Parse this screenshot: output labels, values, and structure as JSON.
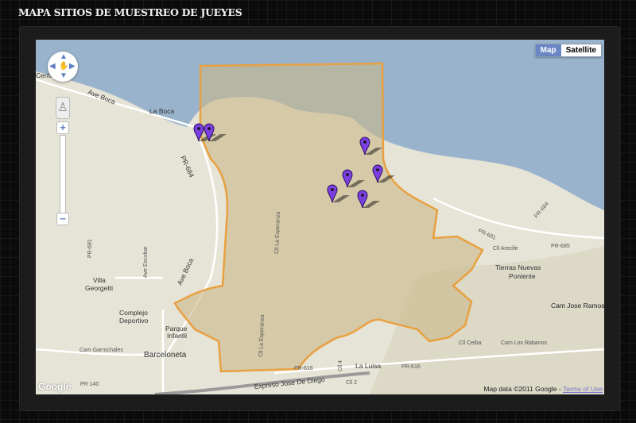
{
  "page_title": "MAPA SITIOS DE MUESTREO DE JUEYES",
  "map": {
    "type_buttons": [
      {
        "label": "Map",
        "active": true
      },
      {
        "label": "Satellite",
        "active": false
      }
    ],
    "attribution": "Map data ©2011 Google",
    "terms_link": "Terms of Use",
    "logo": "Google",
    "colors": {
      "sea": "#99b3cc",
      "land": "#e6e4d6",
      "polygon_fill": "#c9b889",
      "polygon_stroke": "#e8a040",
      "marker": "#7b3fe0"
    },
    "labels": {
      "centro": "Centro",
      "ave_boca_1": "Ave Boca",
      "la_boca": "La Boca",
      "pr684": "PR-684",
      "pr681": "PR-681",
      "ave_boca_2": "Ave Boca",
      "cll_esperanza_1": "Cll La Esperanza",
      "cll_esperanza_2": "Cll La Esperanza",
      "villa": "Villa",
      "georgetti": "Georgetti",
      "complejo": "Complejo",
      "deportivo": "Deportivo",
      "parque": "Parque",
      "infantil": "Infantil",
      "ave_escobar": "Ave Escobar",
      "barceloneta": "Barceloneta",
      "cam_garrochales": "Cam Garrochales",
      "pr140": "PR 140",
      "expreso": "Expreso Jose De Diego",
      "pr616_1": "PR-616",
      "pr616_2": "PR-616",
      "la_luisa": "La Luisa",
      "cll2": "Cll 2",
      "cll4": "Cll 4",
      "cll_ceiba": "Cll Ceiba",
      "cam_rabanos": "Cam Los Rabanos",
      "tierras": "Tierras Nuevas",
      "poniente": "Poniente",
      "cll_arecife": "Cll Arecife",
      "pr685": "PR-685",
      "pr684b": "PR-684",
      "pr681b": "PR-681",
      "cam_jose": "Cam Jose Ramos"
    },
    "markers": [
      "sitio-1",
      "sitio-2",
      "sitio-3",
      "sitio-4",
      "sitio-5",
      "sitio-6",
      "sitio-7"
    ]
  }
}
